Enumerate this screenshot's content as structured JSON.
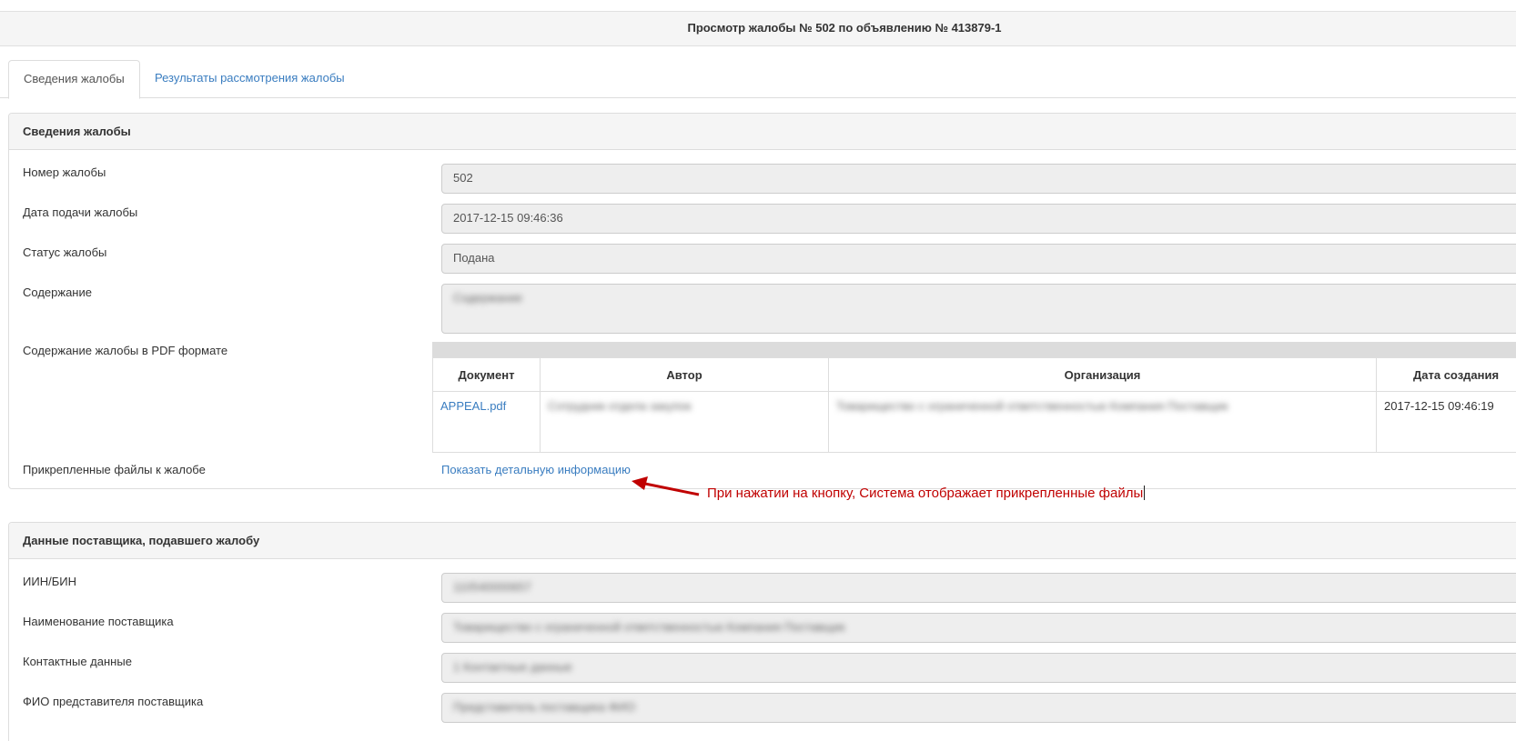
{
  "page": {
    "title": "Просмотр жалобы № 502 по объявлению № 413879-1"
  },
  "tabs": [
    {
      "label": "Сведения жалобы",
      "active": true
    },
    {
      "label": "Результаты рассмотрения жалобы",
      "active": false
    }
  ],
  "complaint_panel": {
    "heading": "Сведения жалобы",
    "fields": {
      "number": {
        "label": "Номер жалобы",
        "value": "502"
      },
      "date": {
        "label": "Дата подачи жалобы",
        "value": "2017-12-15 09:46:36"
      },
      "status": {
        "label": "Статус жалобы",
        "value": "Подана"
      },
      "content": {
        "label": "Содержание",
        "value": "Содержание"
      }
    },
    "pdf": {
      "label": "Содержание жалобы в PDF формате",
      "columns": [
        "Документ",
        "Автор",
        "Организация",
        "Дата создания"
      ],
      "rows": [
        {
          "document": "APPEAL.pdf",
          "author": "Сотрудник отдела закупок",
          "organization": "Товарищество с ограниченной ответственностью Компания Поставщик",
          "created": "2017-12-15 09:46:19"
        }
      ]
    },
    "attachments": {
      "label": "Прикрепленные файлы к жалобе",
      "link": "Показать детальную информацию"
    }
  },
  "annotation": {
    "text": "При нажатии на кнопку, Система отображает прикрепленные файлы",
    "color": "#c00000"
  },
  "supplier_panel": {
    "heading": "Данные поставщика, подавшего жалобу",
    "fields": {
      "iin": {
        "label": "ИИН/БИН",
        "value": "110540000657"
      },
      "name": {
        "label": "Наименование поставщика",
        "value": "Товарищество с ограниченной ответственностью Компания Поставщик"
      },
      "contacts": {
        "label": "Контактные данные",
        "value": "1 Контактные данные"
      },
      "representative": {
        "label": "ФИО представителя поставщика",
        "value": "Представитель поставщика ФИО"
      }
    }
  },
  "colors": {
    "link": "#3a7dc0",
    "panel_heading_bg": "#f5f5f5",
    "input_bg": "#eeeeee"
  }
}
